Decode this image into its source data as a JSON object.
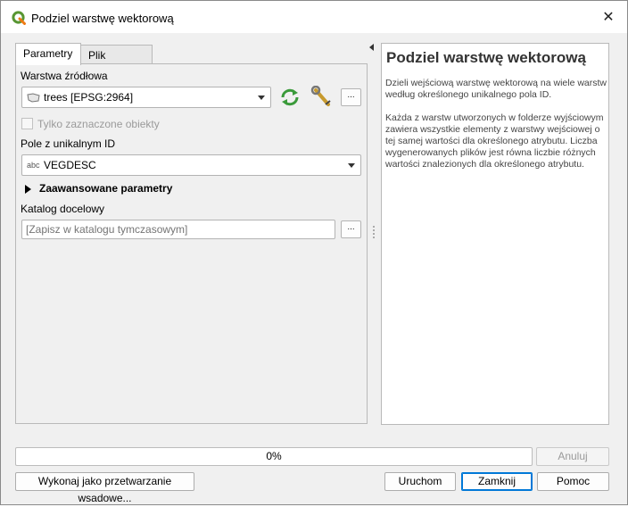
{
  "window": {
    "title": "Podziel warstwę wektorową",
    "close_glyph": "✕"
  },
  "tabs": [
    {
      "label": "Parametry",
      "active": true
    },
    {
      "label": "Plik zdarzeń",
      "active": false
    }
  ],
  "params": {
    "source_layer_label": "Warstwa źródłowa",
    "source_layer_value": "trees [EPSG:2964]",
    "selected_only_label": "Tylko zaznaczone obiekty",
    "unique_field_label": "Pole z unikalnym ID",
    "unique_field_type": "abc",
    "unique_field_value": "VEGDESC",
    "advanced_label": "Zaawansowane parametry",
    "output_dir_label": "Katalog docelowy",
    "output_dir_placeholder": "[Zapisz w katalogu tymczasowym]",
    "dots": "..."
  },
  "help": {
    "title": "Podziel warstwę wektorową",
    "paragraph1": "Dzieli wejściową warstwę wektorową na wiele warstw według określonego unikalnego pola ID.",
    "paragraph2": "Każda z warstw utworzonych w folderze wyjściowym zawiera wszystkie elementy z warstwy wejściowej o tej samej wartości dla określonego atrybutu. Liczba wygenerowanych plików jest równa liczbie różnych wartości znalezionych dla określonego atrybutu."
  },
  "progress": {
    "value": 0,
    "text": "0%"
  },
  "buttons": {
    "cancel": "Anuluj",
    "batch": "Wykonaj jako przetwarzanie wsadowe...",
    "run": "Uruchom",
    "close": "Zamknij",
    "help": "Pomoc"
  },
  "icons": {
    "app": "qgis-logo-icon",
    "layer": "polygon-layer-icon",
    "iterate": "iterate-icon",
    "settings": "wrench-icon"
  },
  "colors": {
    "qgis_green": "#589632",
    "qgis_yellow": "#ee7913",
    "focus_blue": "#0078d7"
  }
}
